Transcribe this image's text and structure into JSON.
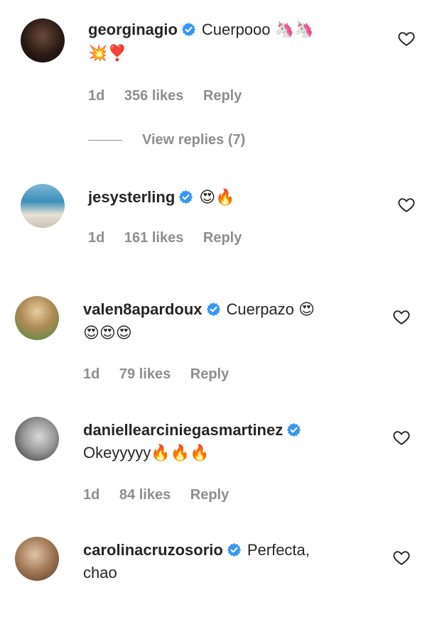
{
  "comments": [
    {
      "username": "georginagio",
      "text": "Cuerpooo",
      "emoji_line1": "🦄🦄",
      "emoji_line2": "💥❣️",
      "time": "1d",
      "likes": "356 likes",
      "reply": "Reply",
      "view_replies": "View replies (7)"
    },
    {
      "username": "jesysterling",
      "text": "",
      "emoji_line1": "😍🔥",
      "time": "1d",
      "likes": "161 likes",
      "reply": "Reply"
    },
    {
      "username": "valen8apardoux",
      "text": "Cuerpazo",
      "emoji_line1": "😍",
      "emoji_line2": "😍😍😍",
      "time": "1d",
      "likes": "79 likes",
      "reply": "Reply"
    },
    {
      "username": "daniellearciniegasmartinez",
      "text": "",
      "line2_text": "Okeyyyyy",
      "emoji_line2": "🔥🔥🔥",
      "time": "1d",
      "likes": "84 likes",
      "reply": "Reply"
    },
    {
      "username": "carolinacruzosorio",
      "text": "Perfecta,",
      "line2_text": "chao"
    }
  ],
  "colors": {
    "text": "#262626",
    "muted": "#8e8e8e",
    "verified": "#3897f0"
  },
  "icons": [
    "verified-badge-icon",
    "heart-icon"
  ]
}
